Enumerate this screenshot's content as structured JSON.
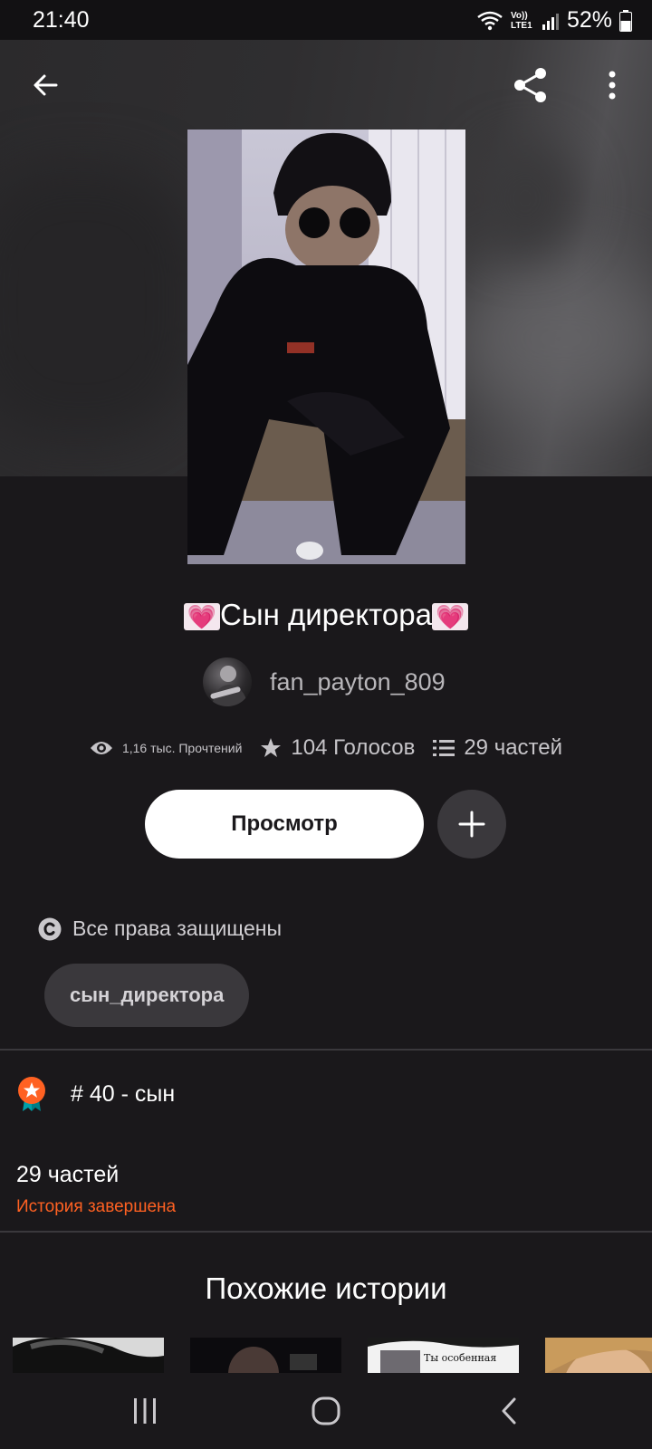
{
  "status_bar": {
    "time": "21:40",
    "network_label": "Vo)) LTE1",
    "battery": "52%"
  },
  "toolbar": {
    "back_icon": "arrow-left-icon",
    "share_icon": "share-icon",
    "more_icon": "more-vertical-icon"
  },
  "story": {
    "title_prefix_emoji": "💗",
    "title": "Сын директора",
    "title_suffix_emoji": "💗",
    "author": "fan_payton_809",
    "reads": "1,16 тыс. Прочтений",
    "votes": "104 Голосов",
    "parts": "29 частей",
    "read_button": "Просмотр",
    "copyright": "Все права защищены",
    "tag": "сын_директора",
    "rank": "# 40 - сын",
    "parts_count": "29 частей",
    "status": "История завершена"
  },
  "similar": {
    "title": "Похожие истории",
    "thumb_caption": "Ты особенная"
  },
  "colors": {
    "background": "#1a181b",
    "accent_orange": "#ff6122",
    "chip": "#3a383c"
  }
}
